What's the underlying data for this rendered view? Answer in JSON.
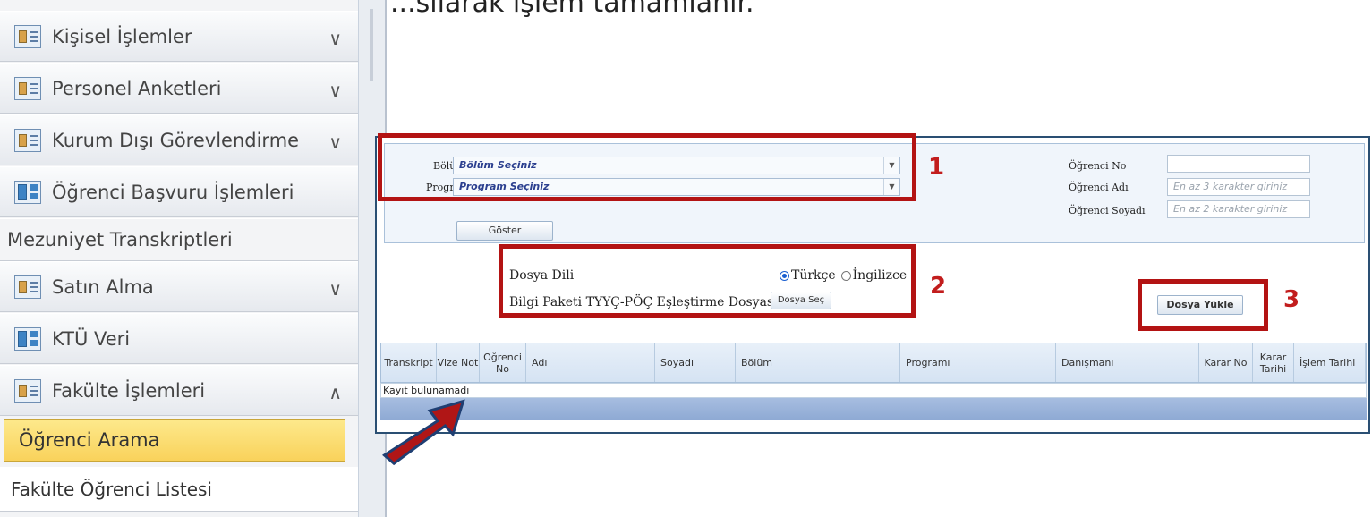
{
  "heading": "...sılarak işlem tamamlanır.",
  "sidebar": {
    "items": [
      {
        "label": "Kişisel İşlemler",
        "chevron": "∨"
      },
      {
        "label": "Personel Anketleri",
        "chevron": "∨"
      },
      {
        "label": "Kurum Dışı Görevlendirme",
        "chevron": "∨"
      },
      {
        "label": "Öğrenci Başvuru İşlemleri"
      },
      {
        "label": "Mezuniyet Transkriptleri"
      },
      {
        "label": "Satın Alma",
        "chevron": "∨"
      },
      {
        "label": "KTÜ Veri"
      },
      {
        "label": "Fakülte İşlemleri",
        "chevron": "∧"
      },
      {
        "label": "Öğrenci Arama"
      },
      {
        "label": "Fakülte Öğrenci Listesi"
      }
    ]
  },
  "filter": {
    "bolum_label": "Bölüm :",
    "bolum_value": "Bölüm Seçiniz",
    "program_label": "Program :",
    "program_value": "Program Seçiniz",
    "goster_label": "Göster",
    "ogrenci_no_label": "Öğrenci No",
    "ogrenci_no_value": "",
    "ogrenci_adi_label": "Öğrenci Adı",
    "ogrenci_adi_placeholder": "En az 3 karakter giriniz",
    "ogrenci_soyadi_label": "Öğrenci Soyadı",
    "ogrenci_soyadi_placeholder": "En az 2 karakter giriniz"
  },
  "upload": {
    "dosya_dili_label": "Dosya Dili",
    "lang_options": [
      "Türkçe",
      "İngilizce"
    ],
    "selected_lang": "Türkçe",
    "bilgi_paketi_label": "Bilgi Paketi TYYÇ-PÖÇ Eşleştirme Dosyası",
    "dosya_sec_label": "Dosya Seç",
    "dosya_yukle_label": "Dosya Yükle"
  },
  "callouts": [
    "1",
    "2",
    "3"
  ],
  "table": {
    "columns": [
      "Transkript",
      "Vize Not",
      "Öğrenci No",
      "Adı",
      "Soyadı",
      "Bölüm",
      "Programı",
      "Danışmanı",
      "Karar No",
      "Karar Tarihi",
      "İşlem Tarihi"
    ],
    "empty_message": "Kayıt bulunamadı"
  },
  "colors": {
    "callout_red": "#b31313",
    "active_item": "#f9d25b",
    "panel_border": "#2a4f73",
    "arrow_red": "#b01616"
  }
}
